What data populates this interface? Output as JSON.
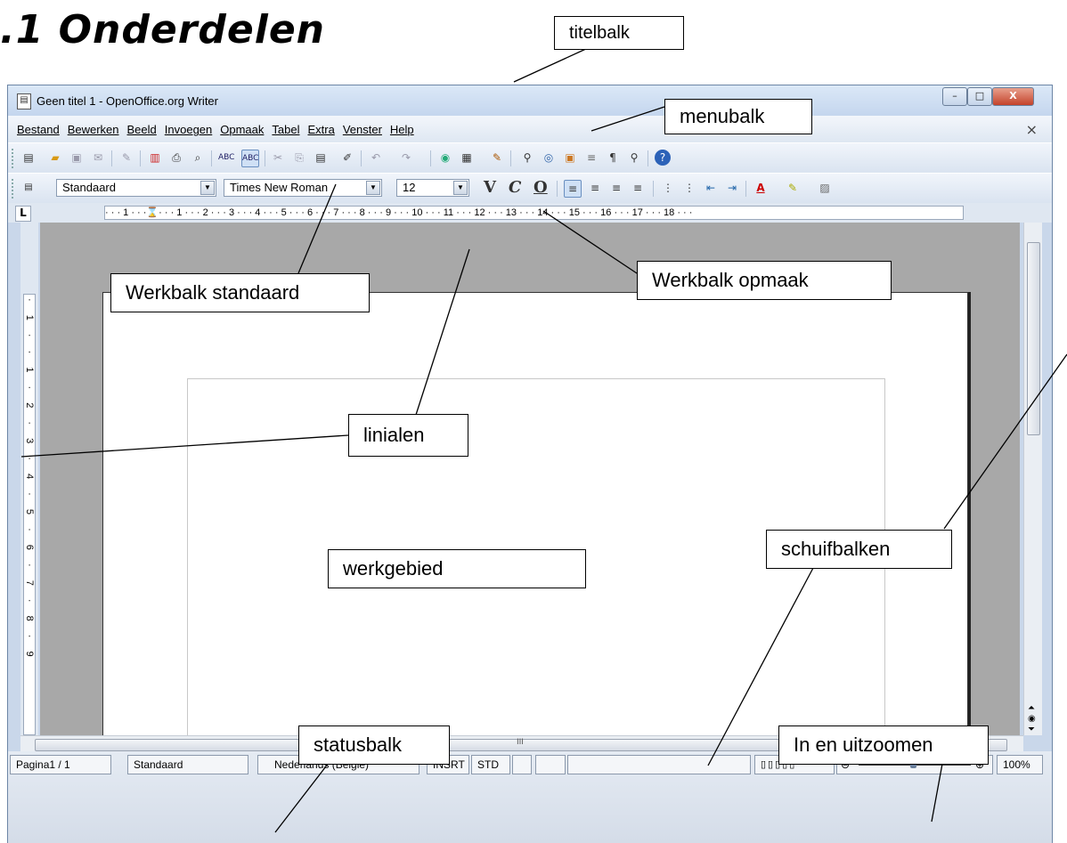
{
  "heading": ".1 Onderdelen",
  "window": {
    "title": "Geen titel 1 - OpenOffice.org Writer",
    "controls": {
      "minimize": "–",
      "maximize": "□",
      "close": "X"
    }
  },
  "menubar": {
    "items": [
      "Bestand",
      "Bewerken",
      "Beeld",
      "Invoegen",
      "Opmaak",
      "Tabel",
      "Extra",
      "Venster",
      "Help"
    ],
    "close": "×"
  },
  "formatting": {
    "style": "Standaard",
    "font": "Times New Roman",
    "size": "12",
    "bold": "V",
    "italic": "C",
    "underline": "O"
  },
  "ruler": {
    "h_text": "· · · 1 · · ·⌛· · · 1 · · · 2 · · · 3 · · · 4 · · · 5 · · · 6 · · · 7 · · · 8 · · · 9 · · · 10 · · · 11 · · · 12 · · · 13 · · · 14 · · · 15 · · · 16 · · · 17 · · · 18 · · ·",
    "v_text": "· 1 · · 1 · 2 · 3 · 4 · 5 · 6 · 7 · 8 · 9",
    "corner": "L"
  },
  "scrollbar": {
    "grip": "III"
  },
  "statusbar": {
    "page": "Pagina1 / 1",
    "style": "Standaard",
    "language": "Nederlands (België)",
    "insert": "INSRT",
    "select": "STD",
    "zoom": "100%"
  },
  "callouts": {
    "titelbalk": "titelbalk",
    "menubalk": "menubalk",
    "werkbalk_standaard": "Werkbalk standaard",
    "werkbalk_opmaak": "Werkbalk opmaak",
    "linialen": "linialen",
    "werkgebied": "werkgebied",
    "schuifbalken": "schuifbalken",
    "statusbalk": "statusbalk",
    "zoom": "In en uitzoomen"
  }
}
